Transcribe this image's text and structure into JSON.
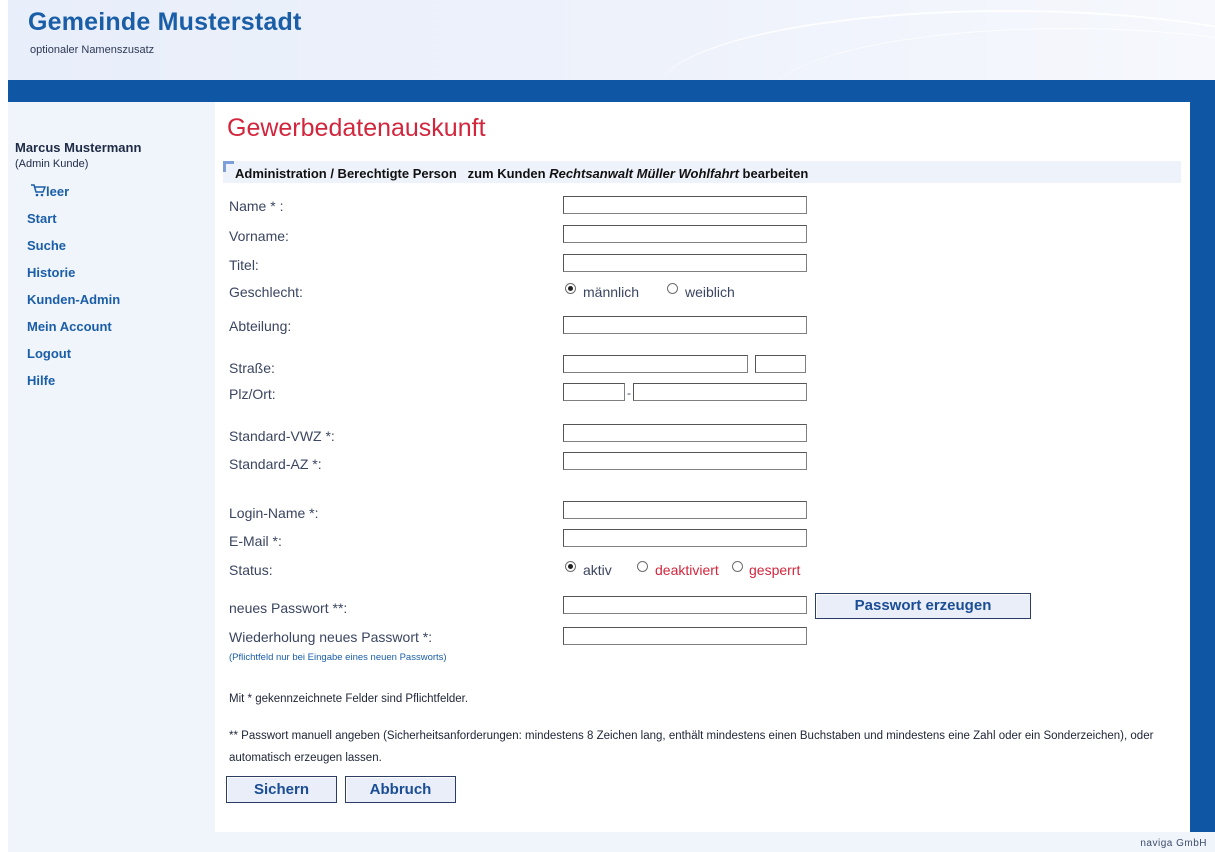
{
  "header": {
    "title": "Gemeinde Musterstadt",
    "subtitle": "optionaler Namenszusatz"
  },
  "user": {
    "name": "Marcus Mustermann",
    "role": "(Admin Kunde)"
  },
  "cart": {
    "label": "leer",
    "icon": "cart-icon"
  },
  "nav": [
    "Start",
    "Suche",
    "Historie",
    "Kunden-Admin",
    "Mein Account",
    "Logout",
    "Hilfe"
  ],
  "page": {
    "title": "Gewerbedatenauskunft"
  },
  "section": {
    "prefix": "Administration / Berechtigte Person   zum Kunden ",
    "customer": "Rechtsanwalt Müller Wohlfahrt",
    "suffix": " bearbeiten"
  },
  "form": {
    "name_label": "Name * :",
    "vorname_label": "Vorname:",
    "titel_label": "Titel:",
    "geschlecht_label": "Geschlecht:",
    "gender_options": [
      "männlich",
      "weiblich"
    ],
    "gender_selected": "männlich",
    "abteilung_label": "Abteilung:",
    "strasse_label": "Straße:",
    "plzort_label": "Plz/Ort:",
    "plz_separator": "-",
    "vwz_label": "Standard-VWZ *:",
    "az_label": "Standard-AZ *:",
    "login_label": "Login-Name *:",
    "email_label": "E-Mail *:",
    "status_label": "Status:",
    "status_options": [
      "aktiv",
      "deaktiviert",
      "gesperrt"
    ],
    "status_selected": "aktiv",
    "pw_label": "neues Passwort **:",
    "pw_button": "Passwort erzeugen",
    "pw2_label": "Wiederholung neues Passwort *:",
    "pw2_hint": "(Pflichtfeld nur bei Eingabe eines neuen Passworts)"
  },
  "notes": {
    "required": "Mit * gekennzeichnete Felder sind Pflichtfelder.",
    "password": "** Passwort manuell angeben (Sicherheitsanforderungen: mindestens 8 Zeichen lang, enthält mindestens einen Buchstaben und mindestens eine Zahl oder ein Sonderzeichen), oder automatisch erzeugen lassen."
  },
  "buttons": {
    "save": "Sichern",
    "cancel": "Abbruch"
  },
  "footer": "naviga GmbH",
  "colors": {
    "brand_blue": "#0f56a5",
    "title_red": "#d2263d",
    "link_blue": "#1a5ea8"
  }
}
